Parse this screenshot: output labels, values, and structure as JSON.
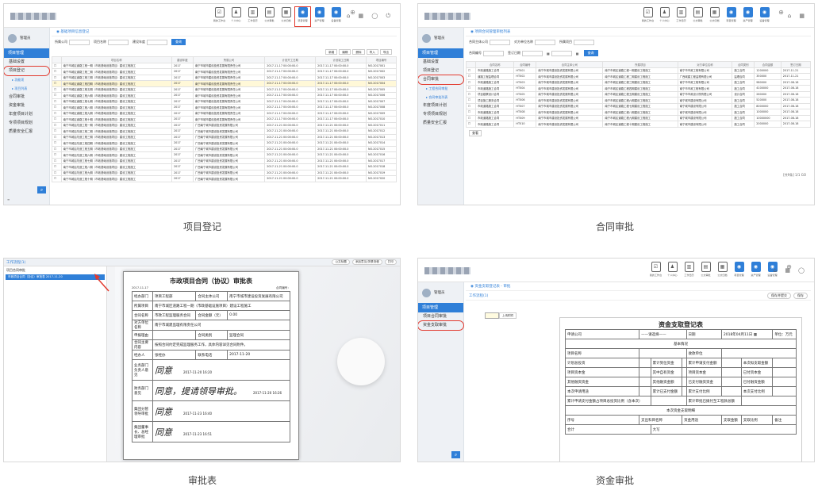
{
  "captions": {
    "p1": "项目登记",
    "p2": "合同审批",
    "p3": "审批表",
    "p4": "资金审批"
  },
  "toolbar_icons": [
    {
      "label": "我的工作台",
      "icon": "checkbox-icon"
    },
    {
      "label": "个人中心",
      "icon": "person-icon"
    },
    {
      "label": "工作日历",
      "icon": "calendar-icon"
    },
    {
      "label": "公文审批",
      "icon": "doc-icon"
    },
    {
      "label": "公文归档",
      "icon": "archive-icon"
    },
    {
      "label": "项目管理",
      "icon": "project-icon"
    },
    {
      "label": "资产管理",
      "icon": "asset-icon"
    },
    {
      "label": "设备管理",
      "icon": "device-icon"
    }
  ],
  "topright": "⌂ ▦ ◯ ⏻",
  "user": {
    "name": "管理员"
  },
  "p1": {
    "section": "项目管理",
    "menu": [
      "基础设置",
      "项目登记",
      "合同审批",
      "资金审批",
      "年度项目计划",
      "专项项目规划",
      "质量安全汇报"
    ],
    "sub": [
      "▸ 功能项",
      "▸ 项目列表"
    ],
    "crumb": "◉ 基础项目信息登记",
    "filter_labels": [
      "所属公司",
      "项目名称",
      "建设年度"
    ],
    "search": "查询",
    "toolbar": [
      "新增",
      "编辑",
      "删除",
      "导入",
      "导出"
    ],
    "headers": [
      "",
      "项目名称",
      "建设年度",
      "所属公司",
      "计划开工日期",
      "计划竣工日期",
      "项目编号"
    ],
    "rows": [
      [
        "☐",
        "南宁市城区道路工程一期（市政基础设施项目）建设工程施工",
        "2017",
        "南宁市城市建设投资发展有限责任公司",
        "2017-11-17 00:00:00.0",
        "2017-11-17 00:00:00.0",
        "NO.2017001"
      ],
      [
        "☐",
        "南宁市城区道路工程二期（市政基础设施项目）建设工程施工",
        "2017",
        "南宁市城市建设投资发展有限责任公司",
        "2017-11-17 00:00:00.0",
        "2017-11-17 00:00:00.0",
        "NO.2017002"
      ],
      [
        "☐",
        "南宁市城区道路工程三期（市政基础设施项目）建设工程施工",
        "2017",
        "南宁市城市建设投资发展有限责任公司",
        "2017-11-17 00:00:00.0",
        "2017-11-17 00:00:00.0",
        "NO.2017003"
      ],
      [
        "☐",
        "南宁市城区道路工程四期（市政基础设施项目）建设工程施工",
        "2017",
        "南宁市城市建设投资发展有限责任公司",
        "2017-11-17 00:00:00.0",
        "2017-11-17 00:00:00.0",
        "NO.2017004"
      ],
      [
        "☐",
        "南宁市城区道路工程五期（市政基础设施项目）建设工程施工",
        "2017",
        "南宁市城市建设投资发展有限责任公司",
        "2017-11-17 00:00:00.0",
        "2017-11-17 00:00:00.0",
        "NO.2017005"
      ],
      [
        "☐",
        "南宁市城区道路工程六期（市政基础设施项目）建设工程施工",
        "2017",
        "南宁市城市建设投资发展有限责任公司",
        "2017-11-17 00:00:00.0",
        "2017-11-17 00:00:00.0",
        "NO.2017006"
      ],
      [
        "☐",
        "南宁市城区道路工程七期（市政基础设施项目）建设工程施工",
        "2017",
        "南宁市城市建设投资发展有限责任公司",
        "2017-11-17 00:00:00.0",
        "2017-11-17 00:00:00.0",
        "NO.2017007"
      ],
      [
        "☐",
        "南宁市城区道路工程八期（市政基础设施项目）建设工程施工",
        "2017",
        "南宁市城市建设投资发展有限责任公司",
        "2017-11-17 00:00:00.0",
        "2017-11-17 00:00:00.0",
        "NO.2017008"
      ],
      [
        "☐",
        "南宁市城区道路工程九期（市政基础设施项目）建设工程施工",
        "2017",
        "南宁市城市建设投资发展有限责任公司",
        "2017-11-17 00:00:00.0",
        "2017-11-17 00:00:00.0",
        "NO.2017009"
      ],
      [
        "☐",
        "南宁市城区道路工程十期（市政基础设施项目）建设工程施工",
        "2017",
        "南宁市城市建设投资发展有限责任公司",
        "2017-11-17 00:00:00.0",
        "2017-11-17 00:00:00.0",
        "NO.2017010"
      ],
      [
        "☐",
        "南宁市城区改造工程一期（市政基础设施项目）建设工程施工",
        "2017",
        "广西南宁城市建设投资发展有限公司",
        "2017-11-21 00:00:00.0",
        "2017-11-21 00:00:00.0",
        "NO.2017011"
      ],
      [
        "☐",
        "南宁市城区改造工程二期（市政基础设施项目）建设工程施工",
        "2017",
        "广西南宁城市建设投资发展有限公司",
        "2017-11-21 00:00:00.0",
        "2017-11-21 00:00:00.0",
        "NO.2017012"
      ],
      [
        "☐",
        "南宁市城区改造工程三期（市政基础设施项目）建设工程施工",
        "2017",
        "广西南宁城市建设投资发展有限公司",
        "2017-11-21 00:00:00.0",
        "2017-11-21 00:00:00.0",
        "NO.2017013"
      ],
      [
        "☐",
        "南宁市城区改造工程四期（市政基础设施项目）建设工程施工",
        "2017",
        "广西南宁城市建设投资发展有限公司",
        "2017-11-21 00:00:00.0",
        "2017-11-21 00:00:00.0",
        "NO.2017014"
      ],
      [
        "☐",
        "南宁市城区改造工程五期（市政基础设施项目）建设工程施工",
        "2017",
        "广西南宁城市建设投资发展有限公司",
        "2017-11-21 00:00:00.0",
        "2017-11-21 00:00:00.0",
        "NO.2017015"
      ],
      [
        "☐",
        "南宁市城区改造工程六期（市政基础设施项目）建设工程施工",
        "2017",
        "广西南宁城市建设投资发展有限公司",
        "2017-11-21 00:00:00.0",
        "2017-11-21 00:00:00.0",
        "NO.2017016"
      ],
      [
        "☐",
        "南宁市城区改造工程七期（市政基础设施项目）建设工程施工",
        "2017",
        "广西南宁城市建设投资发展有限公司",
        "2017-11-21 00:00:00.0",
        "2017-11-21 00:00:00.0",
        "NO.2017017"
      ],
      [
        "☐",
        "南宁市城区改造工程八期（市政基础设施项目）建设工程施工",
        "2017",
        "广西南宁城市建设投资发展有限公司",
        "2017-11-21 00:00:00.0",
        "2017-11-21 00:00:00.0",
        "NO.2017018"
      ],
      [
        "☐",
        "南宁市城区改造工程九期（市政基础设施项目）建设工程施工",
        "2017",
        "广西南宁城市建设投资发展有限公司",
        "2017-11-21 00:00:00.0",
        "2017-11-21 00:00:00.0",
        "NO.2017019"
      ],
      [
        "☐",
        "南宁市城区改造工程十期（市政基础设施项目）建设工程施工",
        "2017",
        "广西南宁城市建设投资发展有限公司",
        "2017-11-21 00:00:00.0",
        "2017-11-21 00:00:00.0",
        "NO.2017020"
      ]
    ]
  },
  "p2": {
    "section": "项目管理",
    "menu": [
      "基础设置",
      "项目登记",
      "合同审批",
      "年度项目计划",
      "专项项目规划",
      "质量安全汇报"
    ],
    "sub": [
      "▸ 工程合同审批",
      "▸ 合同审批列表"
    ],
    "crumb": "◉ 项目合同管理审批列表",
    "filter_labels": [
      "合同主体公司",
      "对方单位名称",
      "所属项目",
      "合同编号",
      "签订日期"
    ],
    "search": "查询",
    "headers": [
      "",
      "合同名称",
      "合同编号",
      "合同主体公司",
      "所属项目",
      "对方单位名称",
      "合同类别",
      "合同金额",
      "签订日期"
    ],
    "rows": [
      [
        "☐",
        "市政道路施工合同",
        "HT001",
        "南宁市城市建设投资发展有限公司",
        "南宁市城区道路工程一期建设工程施工",
        "南宁市市政工程有限公司",
        "施工合同",
        "1200000",
        "2017-11-21"
      ],
      [
        "☐",
        "道路工程监理合同",
        "HT002",
        "南宁市城市建设投资发展有限公司",
        "南宁市城区道路工程二期建设工程施工",
        "广西城建工程监理有限公司",
        "监理合同",
        "350000",
        "2017-11-21"
      ],
      [
        "☐",
        "市政道路施工合同",
        "HT003",
        "南宁市城市建设投资发展有限公司",
        "南宁市城区道路工程三期建设工程施工",
        "南宁市市政工程有限公司",
        "施工合同",
        "980000",
        "2017-08-18"
      ],
      [
        "☐",
        "市政道路施工合同",
        "HT004",
        "南宁市城市建设投资发展有限公司",
        "南宁市城区道路工程四期建设工程施工",
        "南宁市市政工程有限公司",
        "施工合同",
        "4100000",
        "2017-08-18"
      ],
      [
        "☐",
        "项目勘察设计合同",
        "HT005",
        "南宁市城市建设投资发展有限公司",
        "南宁市城区道路工程五期建设工程施工",
        "南宁市市政设计院有限公司",
        "设计合同",
        "260000",
        "2017-08-18"
      ],
      [
        "☐",
        "项目施工服务合同",
        "HT006",
        "南宁市城市建设投资发展有限公司",
        "南宁市城区道路工程六期建设工程施工",
        "南宁城市建设有限公司",
        "施工合同",
        "520000",
        "2017-08-18"
      ],
      [
        "☐",
        "市政道路施工合同",
        "HT007",
        "南宁市城市建设投资发展有限公司",
        "南宁市城区道路工程七期建设工程施工",
        "南宁城市建设有限公司",
        "施工合同",
        "8000000",
        "2017-08-18"
      ],
      [
        "☐",
        "市政道路施工合同",
        "HT008",
        "南宁市城市建设投资发展有限公司",
        "南宁市城区道路工程八期建设工程施工",
        "南宁城市建设有限公司",
        "施工合同",
        "1000000",
        "2017-08-18"
      ],
      [
        "☐",
        "市政道路施工合同",
        "HT009",
        "南宁市城市建设投资发展有限公司",
        "南宁市城区道路工程九期建设工程施工",
        "南宁城市建设有限公司",
        "施工合同",
        "10000000",
        "2017-08-18"
      ],
      [
        "☐",
        "市政道路施工合同",
        "HT010",
        "南宁市城市建设投资发展有限公司",
        "南宁市城区道路工程十期建设工程施工",
        "南宁城市建设有限公司",
        "施工合同",
        "2000000",
        "2017-08-18"
      ]
    ],
    "footer_btn": "查看",
    "pager": "[共9条] 1/1 GO"
  },
  "p3": {
    "tab": "工作流程(1)",
    "list_title": "项目合同审批",
    "list_item": "市政项目合同（协议）审批表 2017-11-20",
    "top_btns": [
      "公文标题",
      "添加意见/关联流程",
      "打印"
    ],
    "doc_title": "市政项目合同（协议）审批表",
    "doc_no": "合同编号：",
    "date": "2017-11-17",
    "rows": [
      [
        "经办部门",
        "项目工程部",
        "合同主体公司",
        "南宁市城市建设投资发展有限公司"
      ],
      [
        "所属项目",
        "南宁市城区道路工程一期（市政基础设施项目）建设工程施工",
        null,
        null
      ],
      [
        "合同名称",
        "市政工程监理服务合同",
        "合同金额（元）",
        "0.00"
      ],
      [
        "对方单位名称",
        "南宁市城建监理有限责任公司",
        null,
        null
      ],
      [
        "申报理由",
        "",
        "合同类别",
        "监理合同"
      ],
      [
        "合同主要内容",
        "按照合同约定完成监理服务工作，具体内容详见合同附件。",
        null,
        null
      ],
      [
        "经办人",
        "张经办",
        "联系电话",
        "2017-11-20"
      ]
    ],
    "sign_rows": [
      [
        "业务部门负责人意见",
        "同意",
        "2017-11-20 16:20"
      ],
      [
        "财务部门意见",
        "同意，提请领导审批。",
        "2017-11-20 16:26"
      ],
      [
        "集团分管领导审批",
        "同意",
        "2017-11-23 16:40"
      ],
      [
        "集团董事长、总经理审批",
        "同意",
        "2017-11-23 16:51"
      ]
    ]
  },
  "p4": {
    "section": "项目管理",
    "menu": [
      "项目合同审批",
      "资金支取审批"
    ],
    "crumb": "◉ 资金支取登记表 - 审批",
    "tab": "工作流程(1)",
    "btns": [
      "保存并提交",
      "保存"
    ],
    "side_input_btn": "上传附件",
    "form_title": "资金支取登记表",
    "unit": "单位：万元",
    "head_row": [
      "申请公司",
      "——请选择——",
      "日期",
      "2018年04月11日 ▦"
    ],
    "section_basic": "基本情况",
    "fields": [
      [
        "项目名称",
        "",
        "收款单位",
        ""
      ],
      [
        "计划总投资",
        "",
        "累计到位资金",
        "",
        "累计申请支付金额",
        "",
        "本次拟支取金额",
        ""
      ],
      [
        "项目资本金",
        "",
        "其中自有资金",
        "",
        "项目资本金",
        "",
        "已付资本金",
        ""
      ],
      [
        "其他融资资金",
        "",
        "其他融资金额",
        "",
        "已支付融资资金",
        "",
        "已付融资金额",
        ""
      ],
      [
        "本次申请用途",
        "",
        "累计已支付金额",
        "",
        "累计支付比例",
        "",
        "本次支付比例",
        ""
      ]
    ],
    "uses_row": [
      "累计申请支付金额占项目总投资比例（含本次）",
      "",
      "累计审批已拨付至工程款总额",
      ""
    ],
    "section_detail": "本次资金支取明细",
    "detail_headers": [
      "序号",
      "支出科目名称",
      "资金用途",
      "支取金额",
      "支取比例",
      "备注"
    ],
    "total": [
      "合计",
      "大写"
    ]
  }
}
